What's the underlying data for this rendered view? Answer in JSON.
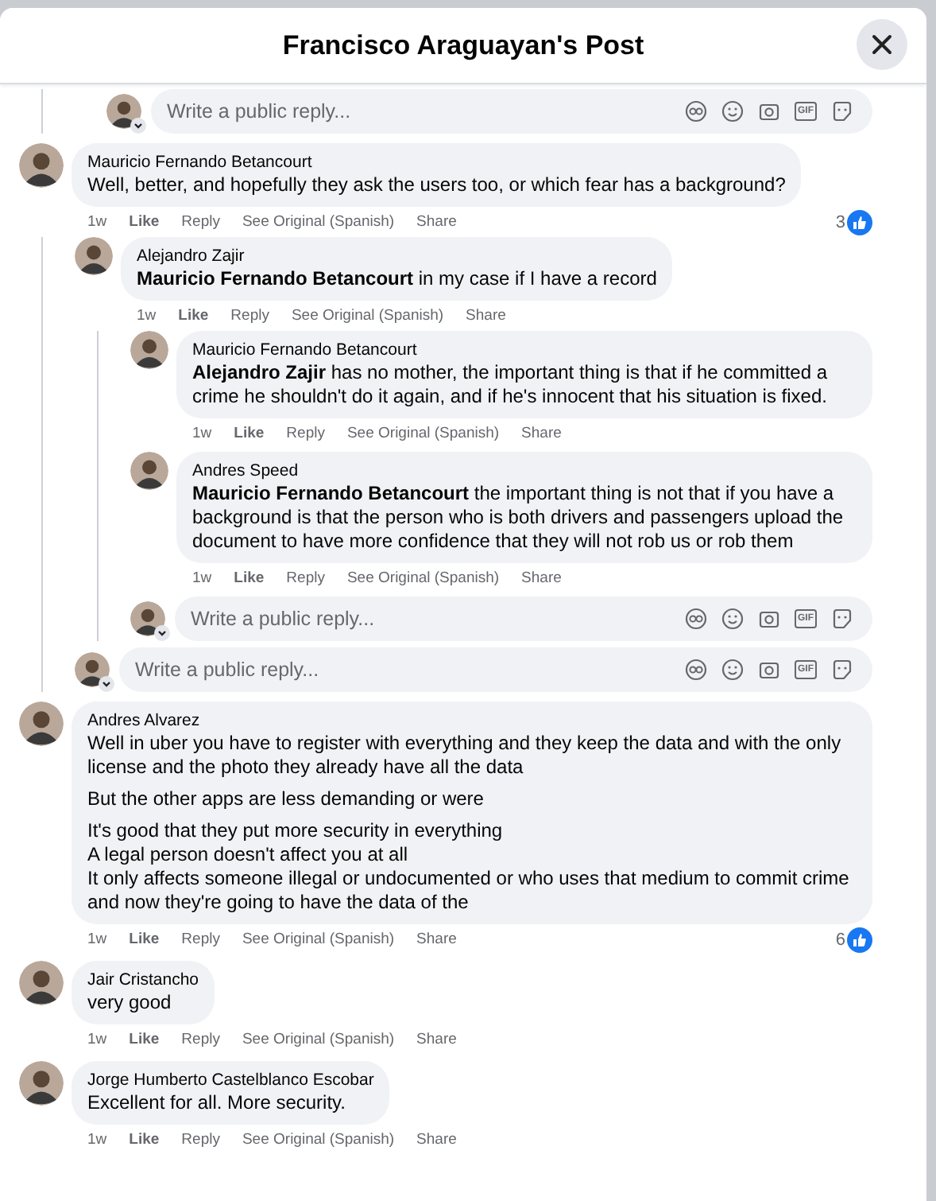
{
  "title": "Francisco Araguayan's Post",
  "top_reply_box": {
    "placeholder": "Write a public reply...",
    "gif_label": "GIF"
  },
  "comments": [
    {
      "author": "Mauricio Fernando Betancourt",
      "paragraphs": [
        "Well, better, and hopefully they ask the users too, or which fear has a background?"
      ],
      "time": "1w",
      "actions": [
        "Like",
        "Reply",
        "See Original (Spanish)",
        "Share"
      ],
      "reactions": "3",
      "replies": [
        {
          "author": "Alejandro Zajir",
          "paragraphs": [
            "**Mauricio Fernando Betancourt** in my case if I have a record"
          ],
          "time": "1w",
          "actions": [
            "Like",
            "Reply",
            "See Original (Spanish)",
            "Share"
          ],
          "replies": [
            {
              "author": "Mauricio Fernando Betancourt",
              "paragraphs": [
                "**Alejandro Zajir** has no mother, the important thing is that if he committed a crime he shouldn't do it again, and if he's innocent that his situation is fixed."
              ],
              "time": "1w",
              "actions": [
                "Like",
                "Reply",
                "See Original (Spanish)",
                "Share"
              ]
            },
            {
              "author": "Andres Speed",
              "paragraphs": [
                "**Mauricio Fernando Betancourt** the important thing is not that if you have a background is that the person who is both drivers and passengers upload the document to have more confidence that they will not rob us or rob them"
              ],
              "time": "1w",
              "actions": [
                "Like",
                "Reply",
                "See Original (Spanish)",
                "Share"
              ]
            }
          ],
          "reply_box": {
            "placeholder": "Write a public reply...",
            "gif_label": "GIF"
          }
        }
      ],
      "reply_box": {
        "placeholder": "Write a public reply...",
        "gif_label": "GIF"
      }
    },
    {
      "author": "Andres Alvarez",
      "paragraphs": [
        "Well in uber you have to register with everything and they keep the data and with the only license and the photo they already have all the data",
        "But the other apps are less demanding or were",
        "It's good that they put more security in everything\nA legal person doesn't affect you at all\nIt only affects someone illegal or undocumented or who uses that medium to commit crime and now they're going to have the data of the"
      ],
      "time": "1w",
      "actions": [
        "Like",
        "Reply",
        "See Original (Spanish)",
        "Share"
      ],
      "reactions": "6"
    },
    {
      "author": "Jair Cristancho",
      "paragraphs": [
        "very good"
      ],
      "time": "1w",
      "actions": [
        "Like",
        "Reply",
        "See Original (Spanish)",
        "Share"
      ]
    },
    {
      "author": "Jorge Humberto Castelblanco Escobar",
      "paragraphs": [
        "Excellent for all. More security."
      ],
      "time": "1w",
      "actions": [
        "Like",
        "Reply",
        "See Original (Spanish)",
        "Share"
      ]
    }
  ]
}
